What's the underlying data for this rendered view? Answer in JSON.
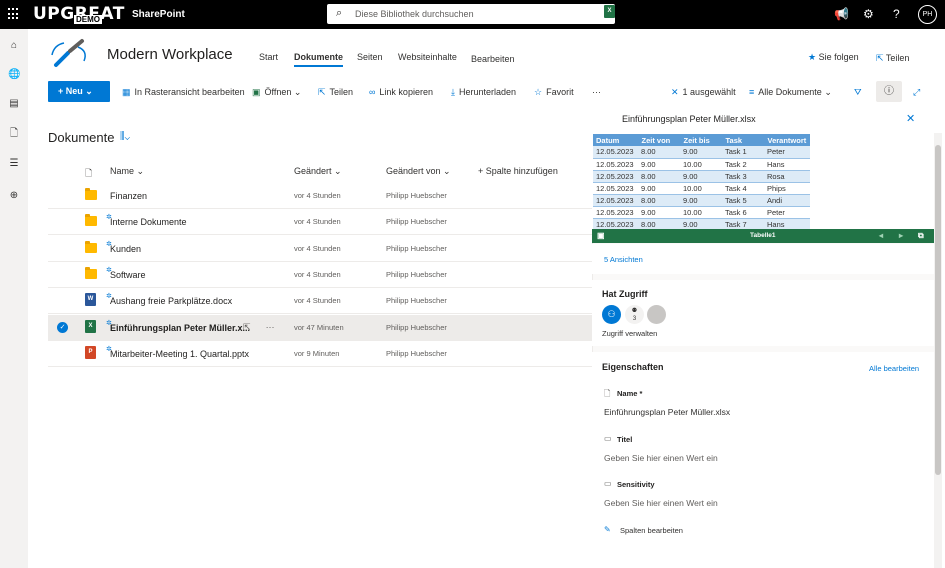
{
  "suitebar": {
    "brand": "UPGREAT",
    "brand_badge": "DEMO",
    "app": "SharePoint",
    "search_placeholder": "Diese Bibliothek durchsuchen",
    "avatar_initials": "PH"
  },
  "site": {
    "title": "Modern Workplace",
    "nav": [
      "Start",
      "Dokumente",
      "Seiten",
      "Websiteinhalte",
      "Bearbeiten"
    ],
    "follow": "Sie folgen",
    "share": "Teilen"
  },
  "commands": {
    "new": "Neu",
    "grid_edit": "In Rasteransicht bearbeiten",
    "open": "Öffnen",
    "share": "Teilen",
    "copy_link": "Link kopieren",
    "download": "Herunterladen",
    "favorite": "Favorit",
    "more": "···",
    "selected": "1 ausgewählt",
    "view": "Alle Dokumente"
  },
  "library": {
    "title": "Dokumente",
    "columns": {
      "name": "Name",
      "modified": "Geändert",
      "modified_by": "Geändert von",
      "add_column": "Spalte hinzufügen"
    },
    "rows": [
      {
        "name": "Finanzen",
        "modified": "vor 4 Stunden",
        "by": "Philipp Huebscher"
      },
      {
        "name": "Interne Dokumente",
        "modified": "vor 4 Stunden",
        "by": "Philipp Huebscher"
      },
      {
        "name": "Kunden",
        "modified": "vor 4 Stunden",
        "by": "Philipp Huebscher"
      },
      {
        "name": "Software",
        "modified": "vor 4 Stunden",
        "by": "Philipp Huebscher"
      },
      {
        "name": "Aushang freie Parkplätze.docx",
        "modified": "vor 4 Stunden",
        "by": "Philipp Huebscher"
      },
      {
        "name": "Einführungsplan Peter Müller.x...",
        "modified": "vor 47 Minuten",
        "by": "Philipp Huebscher"
      },
      {
        "name": "Mitarbeiter-Meeting 1. Quartal.pptx",
        "modified": "vor 9 Minuten",
        "by": "Philipp Huebscher"
      }
    ]
  },
  "details": {
    "file_title": "Einführungsplan Peter Müller.xlsx",
    "preview_headers": [
      "Datum",
      "Zeit von",
      "Zeit bis",
      "Task",
      "Verantwort"
    ],
    "preview_rows": [
      [
        "12.05.2023",
        "8.00",
        "9.00",
        "Task 1",
        "Peter"
      ],
      [
        "12.05.2023",
        "9.00",
        "10.00",
        "Task 2",
        "Hans"
      ],
      [
        "12.05.2023",
        "8.00",
        "9.00",
        "Task 3",
        "Rosa"
      ],
      [
        "12.05.2023",
        "9.00",
        "10.00",
        "Task 4",
        "Phips"
      ],
      [
        "12.05.2023",
        "8.00",
        "9.00",
        "Task 5",
        "Andi"
      ],
      [
        "12.05.2023",
        "9.00",
        "10.00",
        "Task 6",
        "Peter"
      ],
      [
        "12.05.2023",
        "8.00",
        "9.00",
        "Task 7",
        "Hans"
      ]
    ],
    "sheet_name": "Tabelle1",
    "views": "5 Ansichten",
    "access_title": "Hat Zugriff",
    "access_count": "3",
    "manage_access": "Zugriff verwalten",
    "properties_title": "Eigenschaften",
    "edit_all": "Alle bearbeiten",
    "name_label": "Name *",
    "name_value": "Einführungsplan Peter Müller.xlsx",
    "title_label": "Titel",
    "title_value": "Geben Sie hier einen Wert ein",
    "sensitivity_label": "Sensitivity",
    "sensitivity_value": "Geben Sie hier einen Wert ein",
    "edit_columns": "Spalten bearbeiten"
  },
  "colors": {
    "accent": "#0078d4",
    "excel": "#217346",
    "suitebar": "#000000"
  }
}
